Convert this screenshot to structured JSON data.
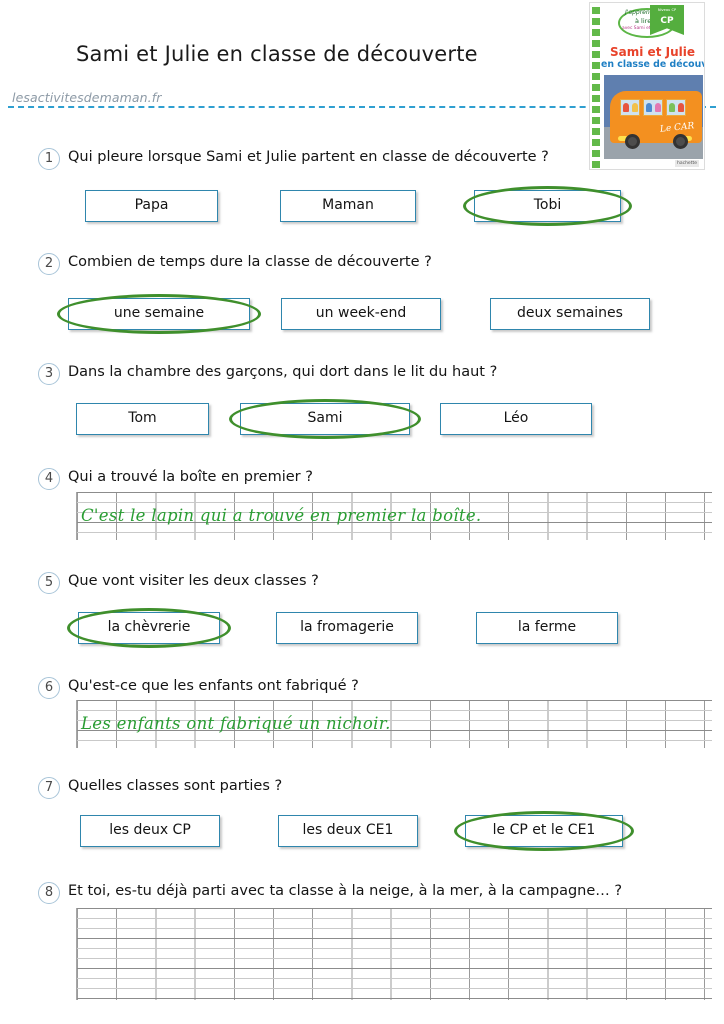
{
  "header": {
    "title": "Sami et Julie en classe de découverte",
    "watermark": "lesactivitesdemaman.fr"
  },
  "book_cover": {
    "badge_line1": "J'apprends",
    "badge_line2": "à lire",
    "badge_line3": "avec Sami et Julie",
    "level_small": "Niveau CP",
    "level": "CP",
    "title_line1": "Sami et Julie",
    "title_line2": "en classe de découverte",
    "bus_script": "Le CAR",
    "publisher": "hachette"
  },
  "colors": {
    "box_border": "#2f86ad",
    "circle_green": "#3f8f2c",
    "handwriting_green": "#2a9d33",
    "rule_blue": "#2f9fd0",
    "number_circle": "#a8c4d8"
  },
  "questions": [
    {
      "number": "1",
      "text": "Qui pleure lorsque Sami et Julie partent en classe de découverte ?",
      "type": "choices",
      "choices": [
        {
          "label": "Papa",
          "selected": false
        },
        {
          "label": "Maman",
          "selected": false
        },
        {
          "label": "Tobi",
          "selected": true
        }
      ]
    },
    {
      "number": "2",
      "text": "Combien de temps dure la classe de découverte ?",
      "type": "choices",
      "choices": [
        {
          "label": "une semaine",
          "selected": true
        },
        {
          "label": "un week-end",
          "selected": false
        },
        {
          "label": "deux semaines",
          "selected": false
        }
      ]
    },
    {
      "number": "3",
      "text": "Dans la chambre des garçons, qui dort dans le lit du haut ?",
      "type": "choices",
      "choices": [
        {
          "label": "Tom",
          "selected": false
        },
        {
          "label": "Sami",
          "selected": true
        },
        {
          "label": "Léo",
          "selected": false
        }
      ]
    },
    {
      "number": "4",
      "text": "Qui a trouvé la boîte en premier ?",
      "type": "writing",
      "answer": "C'est le lapin qui a trouvé en premier la boîte."
    },
    {
      "number": "5",
      "text": "Que vont visiter les deux classes ?",
      "type": "choices",
      "choices": [
        {
          "label": "la chèvrerie",
          "selected": true
        },
        {
          "label": "la fromagerie",
          "selected": false
        },
        {
          "label": "la ferme",
          "selected": false
        }
      ]
    },
    {
      "number": "6",
      "text": "Qu'est-ce que les enfants ont fabriqué ?",
      "type": "writing",
      "answer": "Les enfants ont fabriqué un nichoir."
    },
    {
      "number": "7",
      "text": "Quelles classes sont parties ?",
      "type": "choices",
      "choices": [
        {
          "label": "les deux CP",
          "selected": false
        },
        {
          "label": "les deux CE1",
          "selected": false
        },
        {
          "label": "le CP et le CE1",
          "selected": true
        }
      ]
    },
    {
      "number": "8",
      "text": "Et toi, es-tu déjà parti avec ta classe à la neige, à la mer, à la campagne… ?",
      "type": "writing",
      "answer": ""
    }
  ]
}
